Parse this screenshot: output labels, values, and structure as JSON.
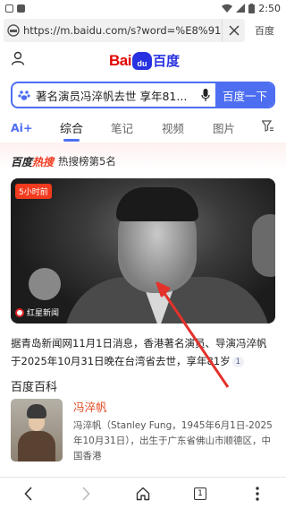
{
  "status_bar": {
    "time": "2:50"
  },
  "url_bar": {
    "url": "https://m.baidu.com/s?word=%E8%91%97%E",
    "go_label": "百度"
  },
  "logo": {
    "bai": "Bai",
    "du": "du",
    "cn": "百度"
  },
  "search": {
    "query": "著名演员冯淬帆去世 享年81...",
    "button": "百度一下"
  },
  "tabs": [
    "Ai+",
    "综合",
    "笔记",
    "视频",
    "图片"
  ],
  "active_tab": "综合",
  "hot": {
    "logo_prefix": "百度",
    "logo_hot": "热搜",
    "rank_text": "热搜榜第5名",
    "time_badge": "5小时前",
    "source": "红星新闻"
  },
  "news": {
    "text": "据青岛新闻网11月1日消息，香港著名演员、导演冯淬帆于2025年10月31日晚在台湾省去世，享年81岁",
    "ref": "1"
  },
  "baike": {
    "title": "百度百科",
    "name": "冯淬帆",
    "desc": "冯淬帆（Stanley Fung，1945年6月1日-2025年10月31日），出生于广东省佛山市顺德区，中国香港"
  },
  "bottom_nav": {
    "tab_count": "1"
  },
  "colors": {
    "accent": "#4e6ef2",
    "hot": "#f2391e",
    "annotation": "#e2322b"
  }
}
